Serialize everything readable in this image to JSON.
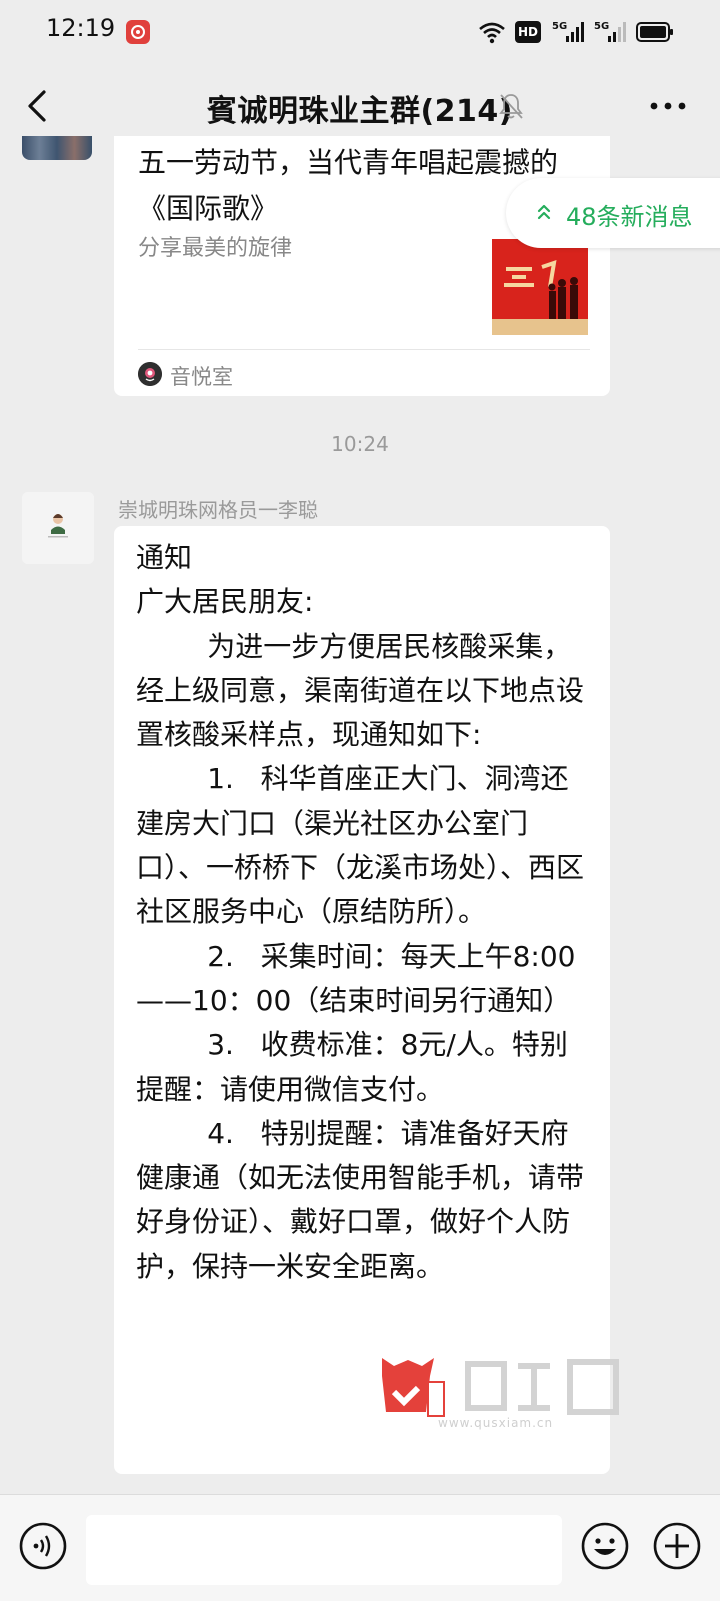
{
  "status_bar": {
    "time": "12:19",
    "network_badge": "HD",
    "icons": [
      "app-notification-icon",
      "wifi-icon",
      "hd-icon",
      "signal-5g-icon",
      "signal-5g-icon",
      "battery-icon"
    ]
  },
  "header": {
    "title": "賓诚明珠业主群(214)",
    "icons": [
      "back-arrow-icon",
      "mute-bell-icon",
      "more-dots-icon"
    ]
  },
  "music_card": {
    "title": "五一劳动节，当代青年唱起震撼的《国际歌》",
    "subtitle": "分享最美的旋律",
    "source": "音悦室"
  },
  "new_messages": {
    "label": "48条新消息"
  },
  "timestamp": "10:24",
  "message": {
    "sender": "崇城明珠网格员一李聪",
    "text": "通知\n广大居民朋友:\n        为进一步方便居民核酸采集，经上级同意，渠南街道在以下地点设置核酸采样点，现通知如下:\n        1.   科华首座正大门、洞湾还建房大门口（渠光社区办公室门口）、一桥桥下（龙溪市场处）、西区社区服务中心（原结防所）。\n        2.   采集时间：每天上午8:00——10：00（结束时间另行通知）\n        3.   收费标准：8元/人。特别提醒：请使用微信支付。\n        4.   特别提醒：请准备好天府健康通（如无法使用智能手机，请带好身份证）、戴好口罩，做好个人防护，保持一米安全距离。"
  },
  "watermark": {
    "text": "www.qusxiam.cn"
  },
  "input_bar": {
    "placeholder": "",
    "icons": [
      "voice-icon",
      "emoji-icon",
      "plus-icon"
    ]
  },
  "colors": {
    "background": "#ededed",
    "bubble": "#ffffff",
    "accent_green": "#25ad5c",
    "muted_text": "#9a9a9a"
  }
}
